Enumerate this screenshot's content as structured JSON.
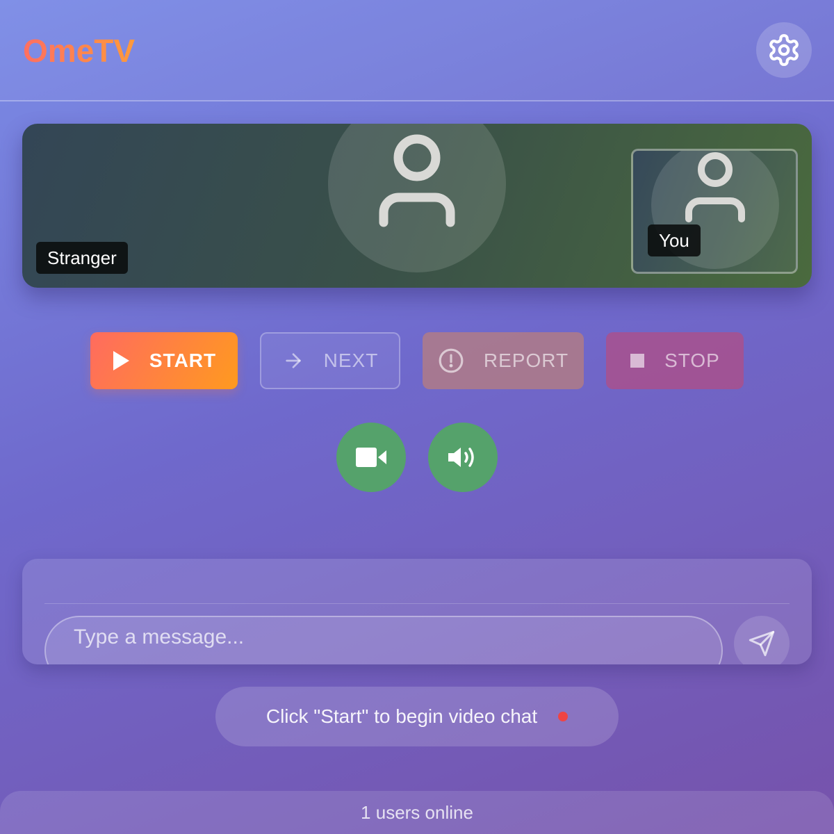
{
  "app": {
    "logo": "OmeTV"
  },
  "header": {
    "settings_icon": "gear-icon"
  },
  "video": {
    "stranger_label": "Stranger",
    "self_label": "You",
    "avatar_icon": "user-icon"
  },
  "controls": {
    "start_label": "START",
    "next_label": "NEXT",
    "report_label": "REPORT",
    "stop_label": "STOP",
    "start_icon": "play-icon",
    "next_icon": "arrow-right-icon",
    "report_icon": "alert-circle-icon",
    "stop_icon": "square-icon"
  },
  "media": {
    "camera_icon": "video-camera-icon",
    "audio_icon": "speaker-icon"
  },
  "chat": {
    "placeholder": "Type a message...",
    "send_icon": "send-icon"
  },
  "status": {
    "text": "Click \"Start\" to begin video chat"
  },
  "footer": {
    "online_text": "1 users online"
  },
  "colors": {
    "brand_gradient_start": "#ff6f61",
    "brand_gradient_end": "#ff9a3c",
    "media_button": "#55a26b",
    "status_dot": "#ef4444"
  }
}
